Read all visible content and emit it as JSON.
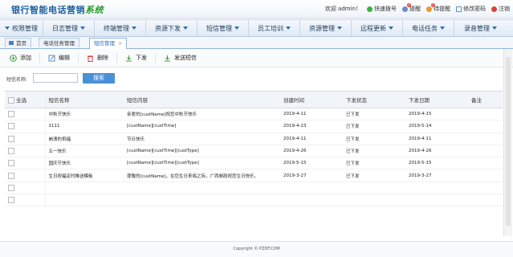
{
  "app": {
    "title_main": "银行智能电话营销",
    "title_highlight": "系统"
  },
  "header": {
    "welcome": "欢迎 admin！",
    "quick_dial": "快速拨号",
    "remind": "提醒",
    "remind_badge": "0",
    "pending": "待提醒",
    "pending_badge": "0",
    "change_pwd": "修改密码",
    "logout": "注销"
  },
  "menu": [
    "权限管理",
    "日志管理",
    "终端管理",
    "资源下发",
    "短信管理",
    "员工培训",
    "资源管理",
    "远程更新",
    "电话任务",
    "录音管理"
  ],
  "tabs": [
    "首页",
    "电话任务管理",
    "短信管理"
  ],
  "toolbar": {
    "add": "添加",
    "edit": "编辑",
    "delete": "删除",
    "issue": "下发",
    "send_sms": "发送短信"
  },
  "search": {
    "label": "短信名称:",
    "value": "",
    "button": "搜索"
  },
  "table": {
    "headers": [
      "全选",
      "短信名称",
      "短信内容",
      "创建时间",
      "下发状态",
      "下发日期",
      "备注"
    ],
    "rows": [
      [
        "中秋节快乐",
        "亲爱的[custName]祝您中秋节快乐",
        "2019-4-11",
        "已下发",
        "2019-4-15",
        ""
      ],
      [
        "1111",
        "[custName][custTime]",
        "2019-4-23",
        "已下发",
        "2019-5-14",
        ""
      ],
      [
        "崩溃的祝福",
        "节日快乐",
        "2019-4-11",
        "已下发",
        "2019-4-11",
        ""
      ],
      [
        "五一快乐",
        "[custName][custTime][custType]",
        "2019-4-26",
        "已下发",
        "2019-4-26",
        ""
      ],
      [
        "国庆节快乐",
        "[custName][custTime][custType]",
        "2019-5-15",
        "已下发",
        "2019-5-15",
        ""
      ],
      [
        "生日祝福定时推送模板",
        "尊敬的[custName]，在您生日来临之际，广西邮政祝您生日快乐。",
        "2019-3-27",
        "已下发",
        "2019-3-27",
        ""
      ],
      [
        "",
        "",
        "",
        "",
        "",
        ""
      ],
      [
        "",
        "",
        "",
        "",
        "",
        ""
      ]
    ]
  },
  "footer": "Copyright © PZDF.COM",
  "colors": {
    "brand": "#1f5f9e",
    "accent": "#4a90d6",
    "highlight": "#2a9d2a"
  }
}
